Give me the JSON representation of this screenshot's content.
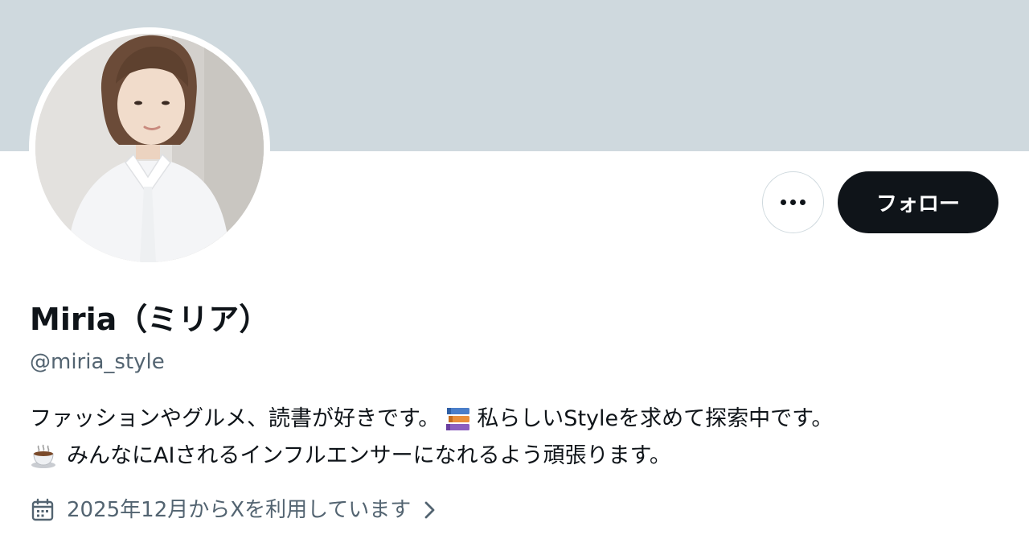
{
  "profile": {
    "display_name": "Miria（ミリア）",
    "handle": "@miria_style",
    "bio": {
      "line1_part1": "ファッションやグルメ、読書が好きです。",
      "line1_emoji": "books-icon",
      "line1_part2": "私らしいStyleを求めて探索中です。",
      "line2_emoji": "coffee-icon",
      "line2_text": "みんなにAIされるインフルエンサーになれるよう頑張ります。"
    },
    "joined_text": "2025年12月からXを利用しています",
    "joined_icon": "calendar-icon"
  },
  "actions": {
    "follow_label": "フォロー",
    "more_icon": "more-horizontal-icon"
  },
  "colors": {
    "banner": "#cfd9de",
    "follow_bg": "#0f1419",
    "text_primary": "#0f1419",
    "text_secondary": "#536471"
  }
}
